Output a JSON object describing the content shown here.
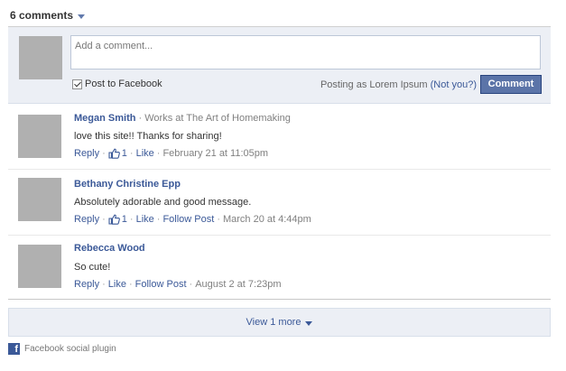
{
  "header": {
    "comment_count": "6 comments"
  },
  "composer": {
    "placeholder": "Add a comment...",
    "post_to_facebook_label": "Post to Facebook",
    "post_to_facebook_checked": true,
    "posting_as_prefix": "Posting as Lorem Ipsum",
    "not_you": "(Not you?)",
    "comment_button": "Comment"
  },
  "comments": [
    {
      "author": "Megan Smith",
      "detail": "· Works at The Art of Homemaking",
      "text": "love this site!! Thanks for sharing!",
      "reply": "Reply",
      "like_count": "1",
      "like": "Like",
      "timestamp": "February 21 at 11:05pm"
    },
    {
      "author": "Bethany Christine Epp",
      "text": "Absolutely adorable and good message.",
      "reply": "Reply",
      "like_count": "1",
      "like": "Like",
      "follow": "Follow Post",
      "timestamp": "March 20 at 4:44pm"
    },
    {
      "author": "Rebecca Wood",
      "text": "So cute!",
      "reply": "Reply",
      "like": "Like",
      "follow": "Follow Post",
      "timestamp": "August 2 at 7:23pm"
    }
  ],
  "view_more": "View 1 more",
  "footer": {
    "label": "Facebook social plugin",
    "icon": "facebook-f-icon"
  },
  "colors": {
    "link": "#3b5998",
    "button": "#5b74a8",
    "composer_bg": "#eceff5"
  }
}
